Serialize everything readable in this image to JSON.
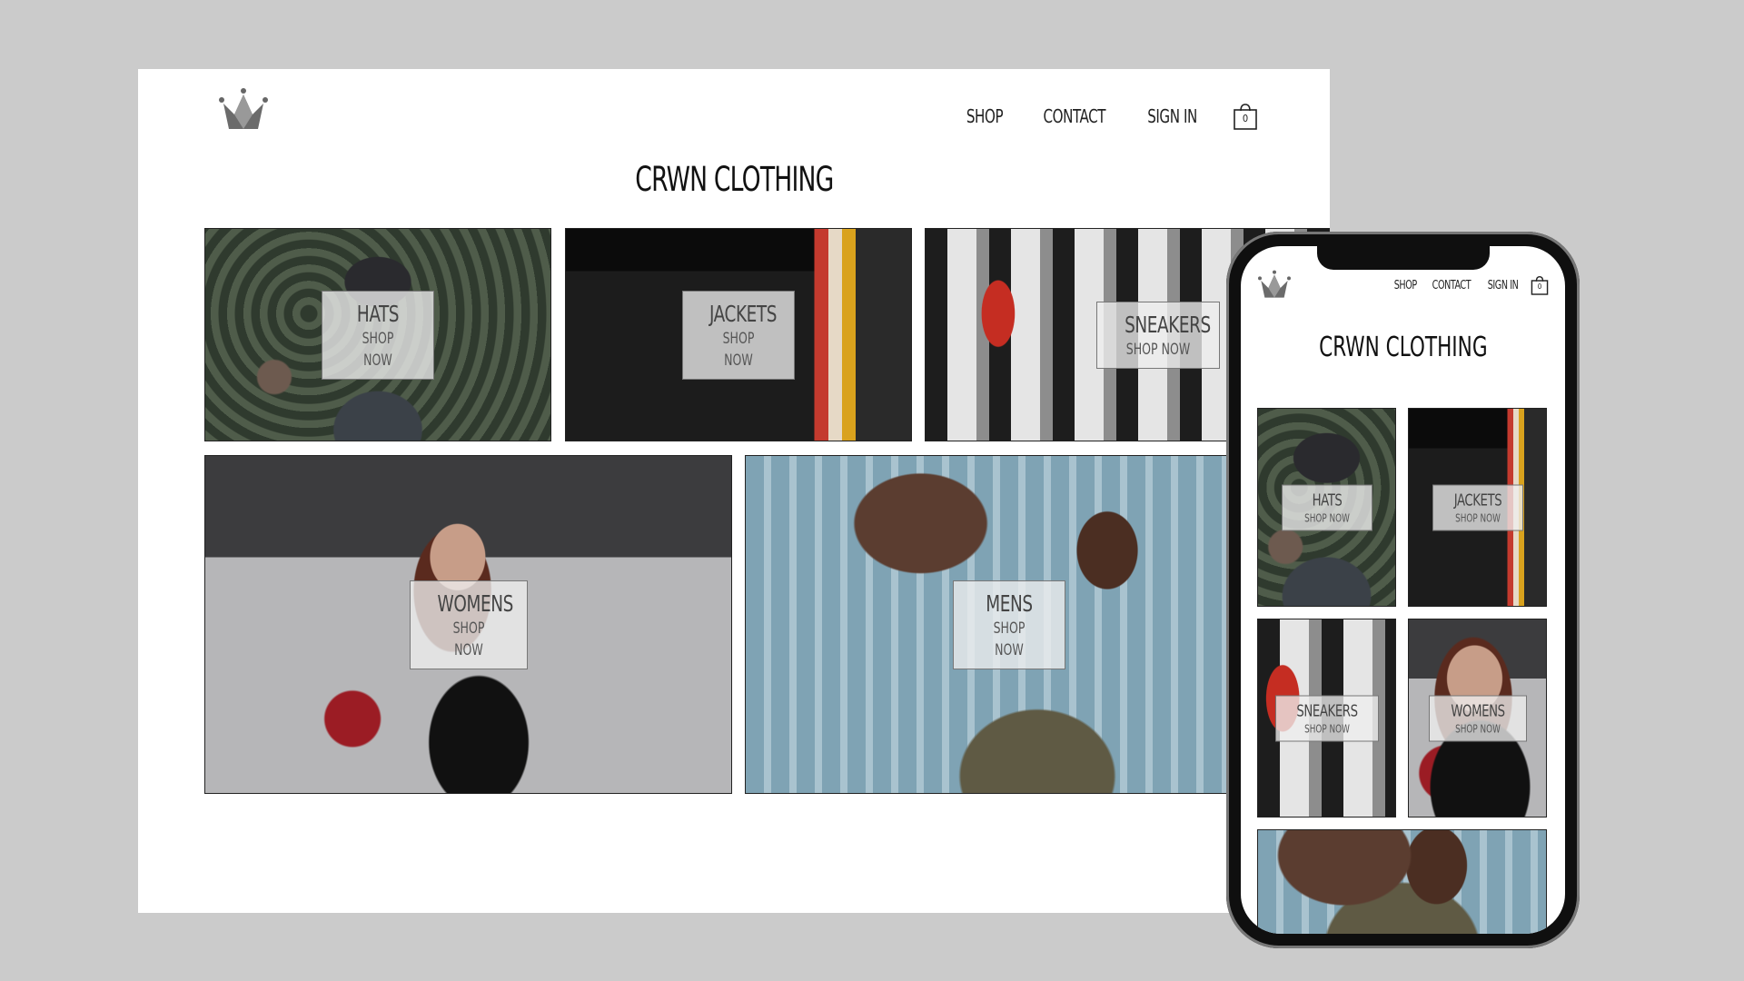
{
  "brand": {
    "logo_icon": "crown-icon"
  },
  "nav": {
    "shop": "SHOP",
    "contact": "CONTACT",
    "sign_in": "SIGN IN",
    "cart_icon": "shopping-bag-icon",
    "cart_count": "0"
  },
  "title": "CRWN CLOTHING",
  "categories": [
    {
      "title": "HATS",
      "cta": "SHOP NOW"
    },
    {
      "title": "JACKETS",
      "cta": "SHOP NOW"
    },
    {
      "title": "SNEAKERS",
      "cta": "SHOP NOW"
    },
    {
      "title": "WOMENS",
      "cta": "SHOP NOW"
    },
    {
      "title": "MENS",
      "cta": "SHOP NOW"
    }
  ],
  "colors": {
    "backdrop": "#cbcbcb",
    "page": "#ffffff",
    "text": "#222222",
    "label_box": "#eeeeee"
  }
}
